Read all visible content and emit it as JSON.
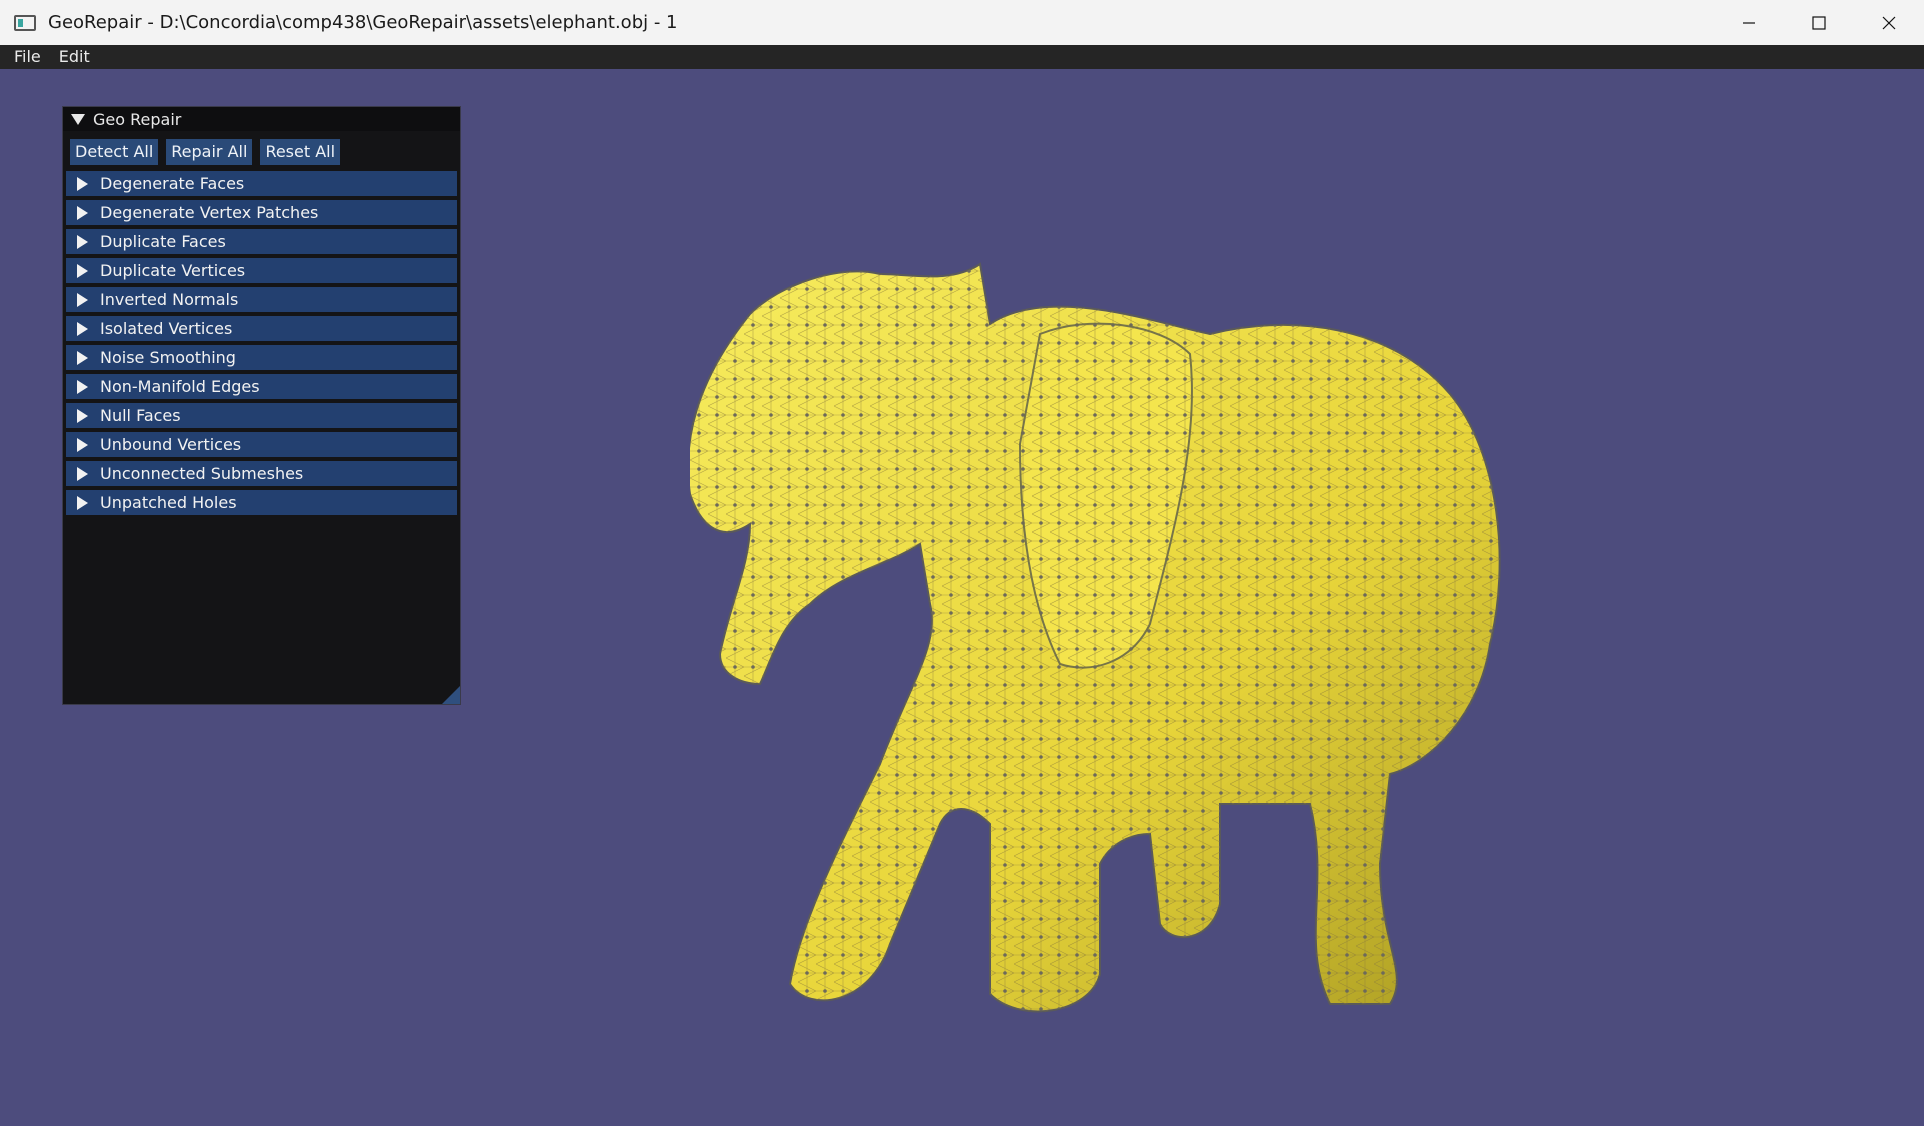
{
  "window": {
    "title": "GeoRepair - D:\\Concordia\\comp438\\GeoRepair\\assets\\elephant.obj - 1",
    "controls": [
      "minimize",
      "maximize",
      "close"
    ]
  },
  "menu": {
    "items": [
      {
        "label": "File"
      },
      {
        "label": "Edit"
      }
    ]
  },
  "panel": {
    "title": "Geo Repair",
    "buttons": {
      "detect_all": "Detect All",
      "repair_all": "Repair All",
      "reset_all": "Reset All"
    },
    "sections": [
      {
        "label": "Degenerate Faces"
      },
      {
        "label": "Degenerate Vertex Patches"
      },
      {
        "label": "Duplicate Faces"
      },
      {
        "label": "Duplicate Vertices"
      },
      {
        "label": "Inverted Normals"
      },
      {
        "label": "Isolated Vertices"
      },
      {
        "label": "Noise Smoothing"
      },
      {
        "label": "Non-Manifold Edges"
      },
      {
        "label": "Null Faces"
      },
      {
        "label": "Unbound Vertices"
      },
      {
        "label": "Unconnected Submeshes"
      },
      {
        "label": "Unpatched Holes"
      }
    ]
  },
  "viewport": {
    "background_color": "#4d4c7d",
    "mesh_color": "#f2e04a",
    "model": "elephant mesh with wireframe vertices"
  }
}
